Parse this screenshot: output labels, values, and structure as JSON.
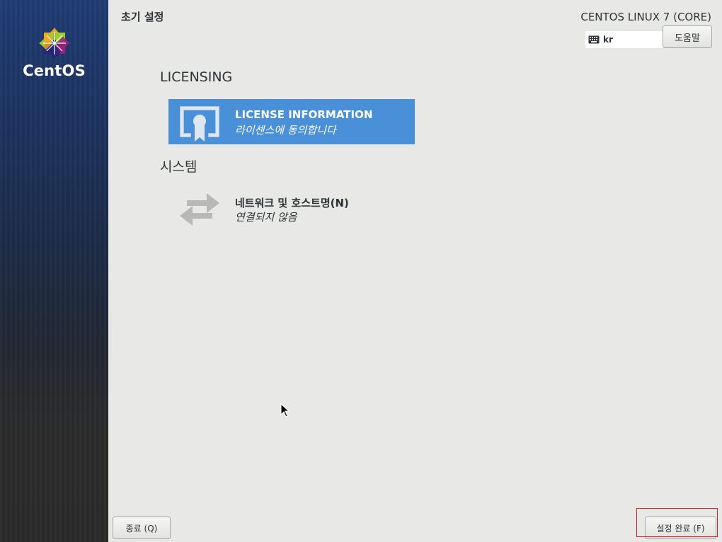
{
  "sidebar": {
    "logo_text": "CentOS",
    "logo_icon": "centos-logo-icon"
  },
  "header": {
    "spoke_title": "초기 설정",
    "distro_name": "CENTOS LINUX 7 (CORE)",
    "keyboard_layout": "kr",
    "keyboard_icon": "keyboard-icon",
    "help_label": "도움말"
  },
  "categories": [
    {
      "title": "LICENSING",
      "spokes": [
        {
          "name": "LICENSE INFORMATION",
          "status": "라이센스에 동의합니다",
          "icon": "certificate-icon",
          "selected": true
        }
      ]
    },
    {
      "title": "시스템",
      "spokes": [
        {
          "name": "네트워크 및 호스트명(N)",
          "status": "연결되지 않음",
          "icon": "network-arrows-icon",
          "selected": false
        }
      ]
    }
  ],
  "footer": {
    "quit_label": "종료 (Q)",
    "finish_label": "설정 완료 (F)"
  },
  "colors": {
    "selected_spoke": "#4a90d9",
    "background": "#e8e8e7",
    "highlight": "#e0201c",
    "sidebar_top": "#1f3c73"
  }
}
